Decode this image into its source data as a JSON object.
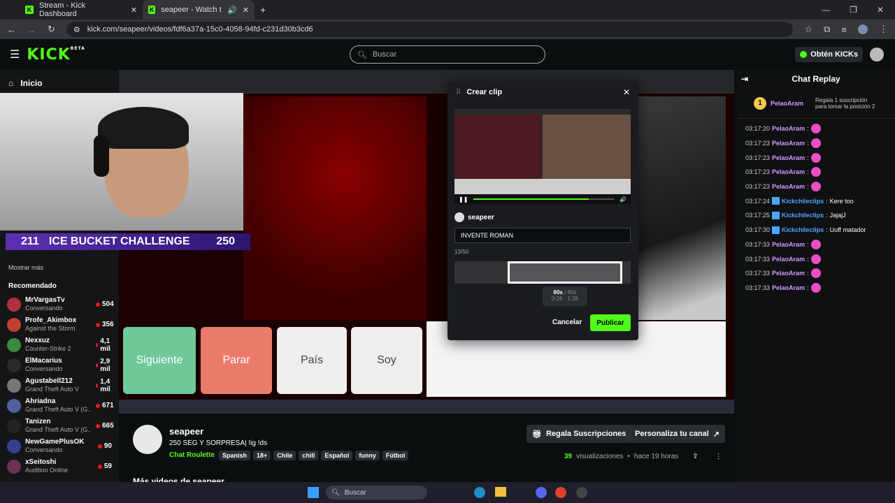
{
  "browser": {
    "tabs": [
      {
        "title": "Stream - Kick Dashboard",
        "active": false
      },
      {
        "title": "seapeer - Watch the VOD o",
        "active": true
      }
    ],
    "new_tab_glyph": "+",
    "url": "kick.com/seapeer/videos/fdf6a37a-15c0-4058-94fd-c231d30b3cd6"
  },
  "header": {
    "logo": "KICK",
    "logo_badge": "BETA",
    "search_placeholder": "Buscar",
    "kicks_label": "Obtén KICKs"
  },
  "sidebar": {
    "inicio_label": "Inicio",
    "show_more": "Mostrar más",
    "recommended_heading": "Recomendado",
    "recommended": [
      {
        "name": "MrVargasTv",
        "sub": "Conversando",
        "viewers": "504",
        "color": "#b03040"
      },
      {
        "name": "Profe_Akimbox",
        "sub": "Against the Storm",
        "viewers": "356",
        "color": "#c04030"
      },
      {
        "name": "Nexxuz",
        "sub": "Counter-Strike 2",
        "viewers": "4,1 mil",
        "color": "#3a8a40"
      },
      {
        "name": "ElMacarius",
        "sub": "Conversando",
        "viewers": "2,9 mil",
        "color": "#2a2a2a"
      },
      {
        "name": "Agustabell212",
        "sub": "Grand Theft Auto V",
        "viewers": "1,4 mil",
        "color": "#777"
      },
      {
        "name": "Ahriadna",
        "sub": "Grand Theft Auto V (G...",
        "viewers": "671",
        "color": "#5060a0"
      },
      {
        "name": "Tanizen",
        "sub": "Grand Theft Auto V (G...",
        "viewers": "665",
        "color": "#222"
      },
      {
        "name": "NewGamePlusOK",
        "sub": "Conversando",
        "viewers": "90",
        "color": "#304090"
      },
      {
        "name": "xSeitoshi",
        "sub": "Audition Online",
        "viewers": "59",
        "color": "#703050"
      }
    ]
  },
  "stream_overlay": {
    "count_left": "211",
    "challenge": "ICE BUCKET CHALLENGE",
    "count_right": "250",
    "buttons": [
      "Siguiente",
      "Parar",
      "País",
      "Soy"
    ]
  },
  "clip_modal": {
    "title": "Crear clip",
    "channel": "seapeer",
    "clip_title_value": "INVENTE ROMAN",
    "char_count": "13/50",
    "duration": "60s",
    "duration_max": "/ 60s",
    "time_range": "0:26 - 1:26",
    "progress_fraction": 0.82,
    "cancel_label": "Cancelar",
    "publish_label": "Publicar"
  },
  "channel_info": {
    "name": "seapeer",
    "title": "250 SEG Y SORPRESA| !ig !ds",
    "category": "Chat Roulette",
    "tags": [
      "Spanish",
      "18+",
      "Chile",
      "chill",
      "Español",
      "funny",
      "Fútbol"
    ],
    "views_count": "39",
    "views_label": "visualizaciones",
    "date": "hace 19 horas",
    "more_videos": "Más videos de seapeer",
    "gift_button": "Regala Suscripciones",
    "customize_button": "Personaliza tu canal"
  },
  "chat": {
    "title": "Chat Replay",
    "pinned_rank": "1",
    "pinned_user": "PelaoAram",
    "pinned_text": "Regala 1 suscripción para tomar la posición 2",
    "messages": [
      {
        "time": "03:17:20",
        "user": "PelaoAram",
        "text": "",
        "color": "#d39bff"
      },
      {
        "time": "03:17:23",
        "user": "PelaoAram",
        "text": "",
        "color": "#d39bff"
      },
      {
        "time": "03:17:23",
        "user": "PelaoAram",
        "text": "",
        "color": "#d39bff"
      },
      {
        "time": "03:17:23",
        "user": "PelaoAram",
        "text": "",
        "color": "#d39bff"
      },
      {
        "time": "03:17:23",
        "user": "PelaoAram",
        "text": "",
        "color": "#d39bff"
      },
      {
        "time": "03:17:24",
        "user": "Kickchileclips",
        "text": "Kere too",
        "color": "#4aa7ff"
      },
      {
        "time": "03:17:25",
        "user": "Kickchileclips",
        "text": "JajajJ",
        "color": "#4aa7ff"
      },
      {
        "time": "03:17:30",
        "user": "Kickchileclips",
        "text": "Uuff matador",
        "color": "#4aa7ff"
      },
      {
        "time": "03:17:33",
        "user": "PelaoAram",
        "text": "",
        "color": "#d39bff"
      },
      {
        "time": "03:17:33",
        "user": "PelaoAram",
        "text": "",
        "color": "#d39bff"
      },
      {
        "time": "03:17:33",
        "user": "PelaoAram",
        "text": "",
        "color": "#d39bff"
      },
      {
        "time": "03:17:33",
        "user": "PelaoAram",
        "text": "",
        "color": "#d39bff"
      }
    ]
  },
  "taskbar": {
    "search_placeholder": "Buscar"
  },
  "colors": {
    "accent": "#53fc18",
    "bg": "#0b0e0f"
  }
}
